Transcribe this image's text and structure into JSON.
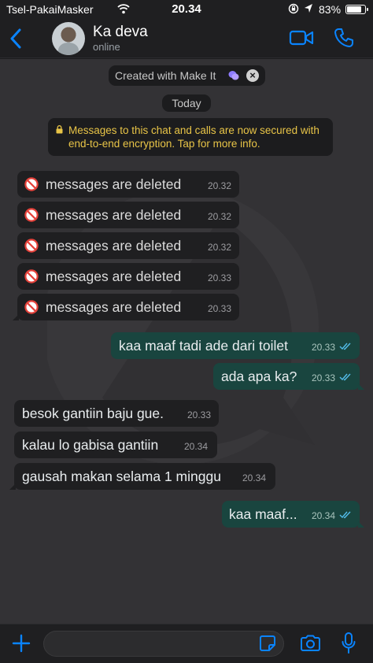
{
  "status_bar": {
    "carrier": "Tsel-PakaiMasker",
    "time": "20.34",
    "battery": "83%"
  },
  "header": {
    "contact_name": "Ka deva",
    "contact_status": "online"
  },
  "banner": {
    "made_with": "Created with Make It",
    "date_label": "Today"
  },
  "encryption_notice": "Messages to this chat and calls are now secured with end-to-end encryption. Tap for more info.",
  "messages": [
    {
      "dir": "in",
      "deleted": true,
      "text": "messages are deleted",
      "time": "20.32"
    },
    {
      "dir": "in",
      "deleted": true,
      "text": "messages are deleted",
      "time": "20.32"
    },
    {
      "dir": "in",
      "deleted": true,
      "text": "messages are deleted",
      "time": "20.32"
    },
    {
      "dir": "in",
      "deleted": true,
      "text": "messages are deleted",
      "time": "20.33"
    },
    {
      "dir": "in",
      "deleted": true,
      "text": "messages are deleted",
      "time": "20.33"
    },
    {
      "dir": "out",
      "text": "kaa maaf tadi ade dari toilet",
      "time": "20.33",
      "status": "read"
    },
    {
      "dir": "out",
      "text": "ada apa ka?",
      "time": "20.33",
      "status": "read"
    },
    {
      "dir": "in",
      "text": "besok gantiin baju gue.",
      "time": "20.33"
    },
    {
      "dir": "in",
      "text": "kalau lo gabisa gantiin",
      "time": "20.34"
    },
    {
      "dir": "in",
      "text": "gausah makan selama 1 minggu",
      "time": "20.34"
    },
    {
      "dir": "out",
      "text": "kaa maaf...",
      "time": "20.34",
      "status": "read"
    }
  ],
  "input": {
    "value": ""
  },
  "colors": {
    "accent": "#0a84ff",
    "outgoing_bubble": "#19453f",
    "incoming_bubble": "#1f1f21",
    "chat_bg": "#333235",
    "read_ticks": "#53bdeb",
    "notice_text": "#e8c447"
  }
}
